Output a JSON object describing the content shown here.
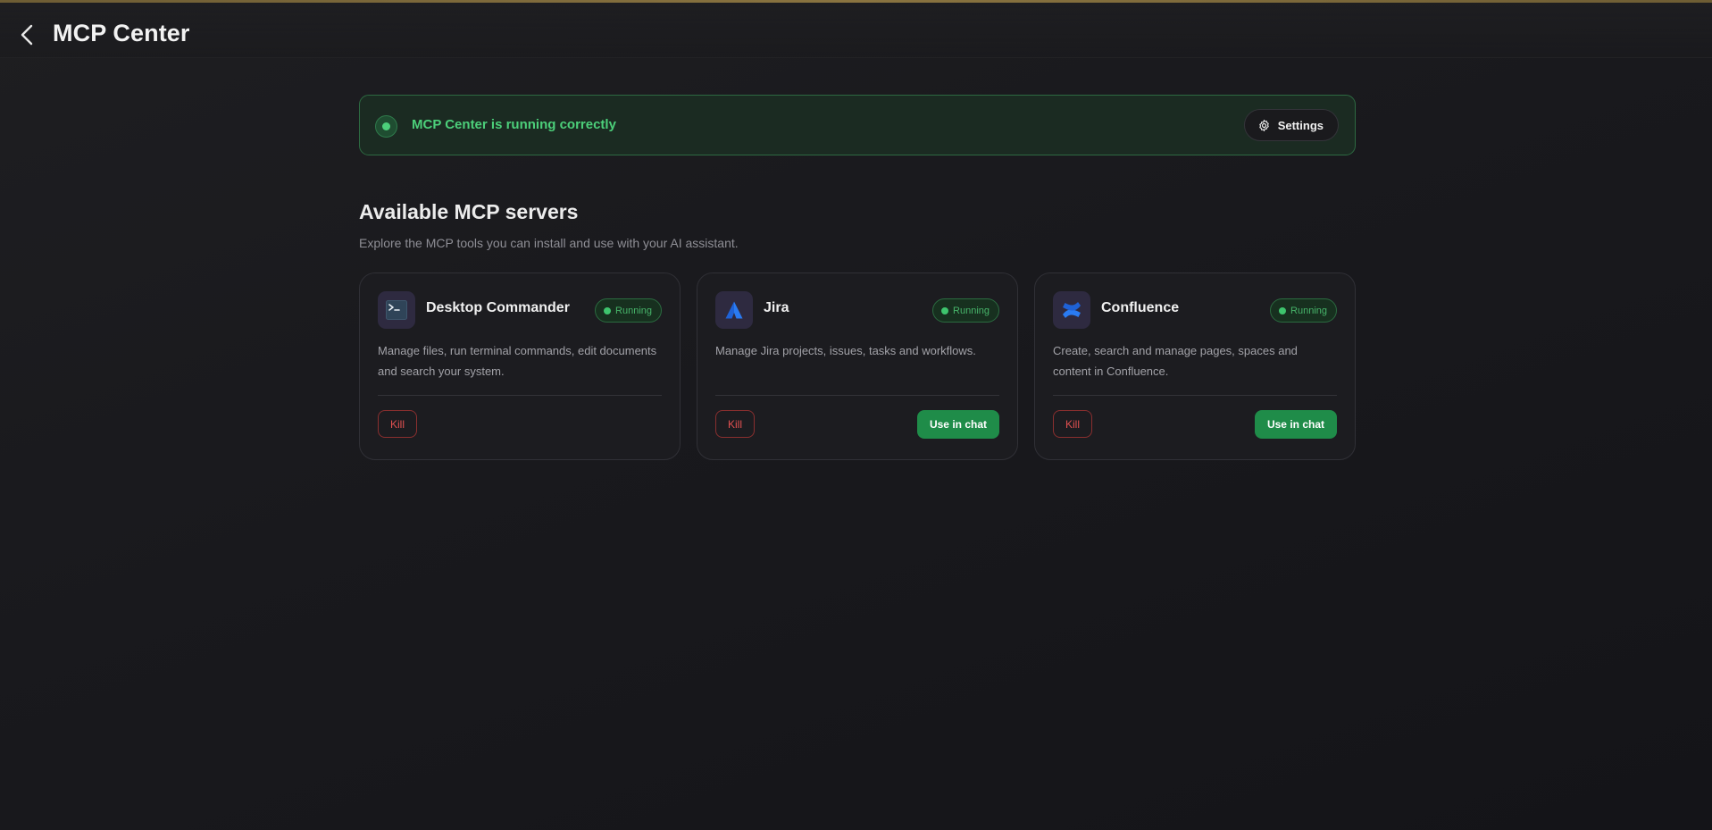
{
  "header": {
    "title": "MCP Center",
    "back_icon": "chevron-left-icon"
  },
  "status": {
    "text": "MCP Center is running correctly",
    "color": "#4ccf7a",
    "settings_label": "Settings",
    "settings_icon": "gear-icon"
  },
  "section": {
    "title": "Available MCP servers",
    "subtitle": "Explore the MCP tools you can install and use with your AI assistant."
  },
  "servers": [
    {
      "name": "Desktop Commander",
      "icon": "terminal-icon",
      "status": "Running",
      "description": "Manage files, run terminal commands, edit documents and search your system.",
      "kill_label": "Kill",
      "use_label": ""
    },
    {
      "name": "Jira",
      "icon": "jira-icon",
      "status": "Running",
      "description": "Manage Jira projects, issues, tasks and workflows.",
      "kill_label": "Kill",
      "use_label": "Use in chat"
    },
    {
      "name": "Confluence",
      "icon": "confluence-icon",
      "status": "Running",
      "description": "Create, search and manage pages, spaces and content in Confluence.",
      "kill_label": "Kill",
      "use_label": "Use in chat"
    }
  ],
  "colors": {
    "accent_green": "#1f8c49",
    "danger_red": "#e05050",
    "background": "#1a1a1d"
  }
}
